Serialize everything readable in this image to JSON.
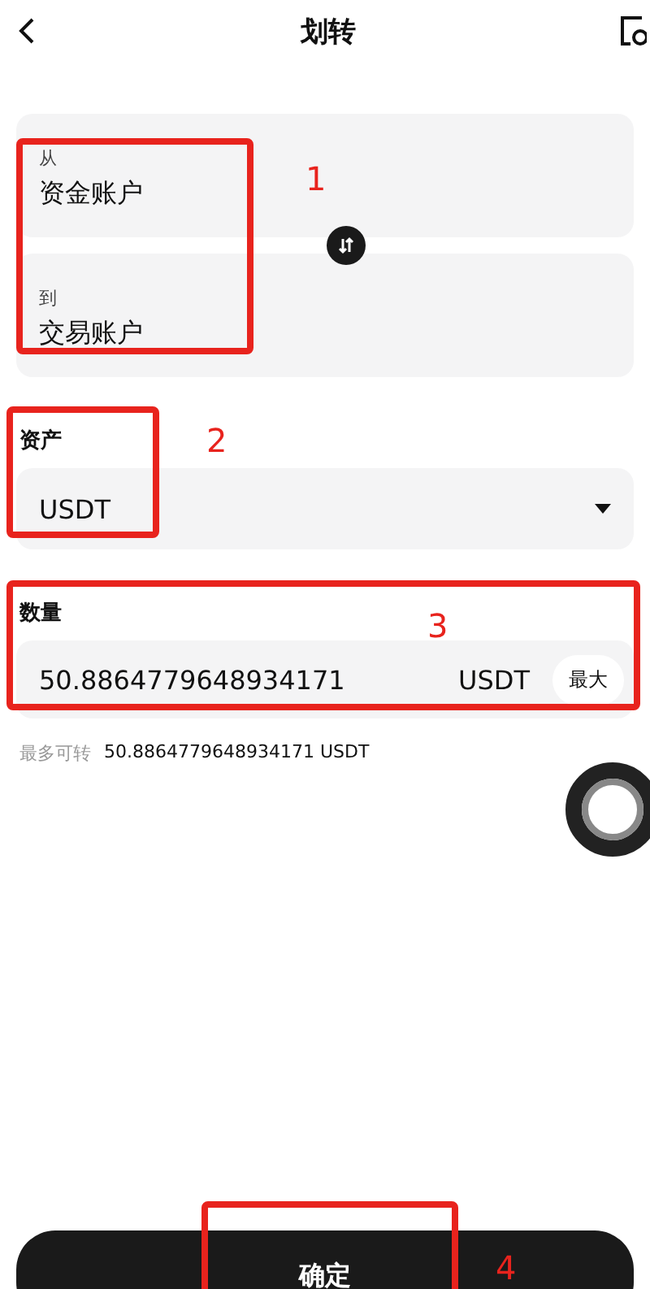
{
  "header": {
    "title": "划转"
  },
  "transfer": {
    "from": {
      "label": "从",
      "value": "资金账户"
    },
    "to": {
      "label": "到",
      "value": "交易账户"
    }
  },
  "asset": {
    "label": "资产",
    "value": "USDT"
  },
  "amount": {
    "label": "数量",
    "value": "50.8864779648934171",
    "unit": "USDT",
    "max_button": "最大"
  },
  "max_transfer": {
    "label": "最多可转",
    "value": "50.8864779648934171 USDT"
  },
  "confirm_button": "确定",
  "annotations": [
    {
      "number": "1"
    },
    {
      "number": "2"
    },
    {
      "number": "3"
    },
    {
      "number": "4"
    }
  ]
}
